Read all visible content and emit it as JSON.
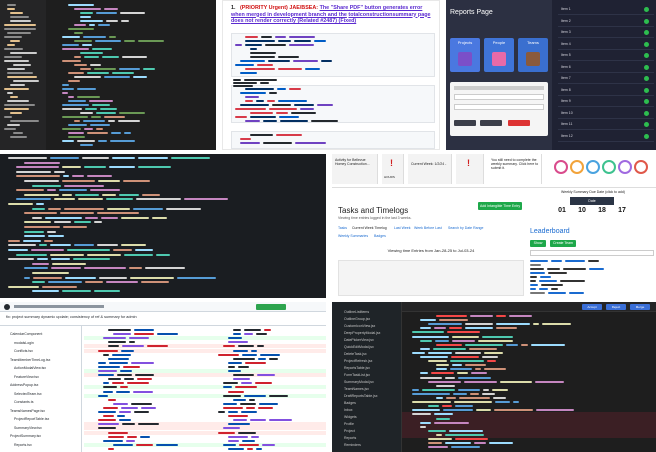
{
  "doc_tile": {
    "issue_number": "1.",
    "priority": "(PRIORITY Urgent) JAE/BSEA:",
    "title_rest": "The \"Share PDF\" button generates error when merged in development branch and the",
    "link_text": "totalconstructionsummary page",
    "title_end": "does not render correctly (Related #2487) (Fixed)"
  },
  "reports_tile": {
    "title": "Reports Page",
    "cards": [
      {
        "label": "Projects"
      },
      {
        "label": "People"
      },
      {
        "label": "Teams"
      }
    ],
    "list_items": [
      "Item 1",
      "Item 2",
      "Item 3",
      "Item 4",
      "Item 5",
      "Item 6",
      "Item 7",
      "Item 8",
      "Item 9",
      "Item 10",
      "Item 11",
      "Item 12"
    ],
    "status_color": "#2dbe4f"
  },
  "tasks_tile": {
    "notice_1": "Activity for Bellevue Homey Construction...",
    "notice_2": "Current Week: 1/2/24 -",
    "notice_3": "You still need to complete the weekly summary. Click here to submit it.",
    "hours_label": "HOURS",
    "title": "Tasks and Timelogs",
    "subtitle": "Viewing time entries logged in the last 3 weeks.",
    "add_button": "Add Intangible Time Entry",
    "tabs": [
      "Tasks",
      "Current Week Timelog",
      "Last Week",
      "Week Before Last",
      "Search by Date Range",
      "Weekly Summaries",
      "Badges"
    ],
    "viewing_text": "Viewing time Entries from Jan-28-25 to Jul-03-24",
    "timer": {
      "banner": "Weekly Summary Due Date (click to add)",
      "date_label": "Date",
      "digits": [
        "01",
        "10",
        "18",
        "17"
      ]
    },
    "leaderboard": {
      "title": "Leaderboard",
      "btn_1": "Show",
      "btn_2": "Create Team"
    }
  },
  "diff_tile": {
    "header": "fix: project summary dynamic update; consistency of ref & summary for admin",
    "files": [
      "CalendarComponent",
      "modalsLogin",
      "Conflicts.tsx",
      "TeamMemberTimeLog.tsx",
      "ActionModalView.tsx",
      "FeatureView.tsx",
      "AddressPopup.tsx",
      "SelectedTeam.tsx",
      "Constants.ts",
      "TeamsNamesPage.tsx",
      "ProjectReportTable.tsx",
      "SummaryView.tsx",
      "ProjectSummary.tsx",
      "Reports.tsx"
    ]
  },
  "editor_tile": {
    "files": [
      "OutlineListItems",
      "OutlineGroup.jsx",
      "CustomIconView.jsx",
      "DeepPropertyModal.jsx",
      "DatePickerView.jsx",
      "QuickEditModal.jsx",
      "DeleteTask.jsx",
      "ProjectRefresh.jsx",
      "ReportsTable.jsx",
      "FormTaskList.jsx",
      "SummaryModal.jsx",
      "TeamNames.jsx",
      "DraftReportsTable.jsx",
      "Badges",
      "Inbox",
      "Widgets",
      "Profile",
      "Project",
      "Reports",
      "Reminders"
    ],
    "buttons": [
      "Accept",
      "Reject",
      "Merge"
    ]
  }
}
